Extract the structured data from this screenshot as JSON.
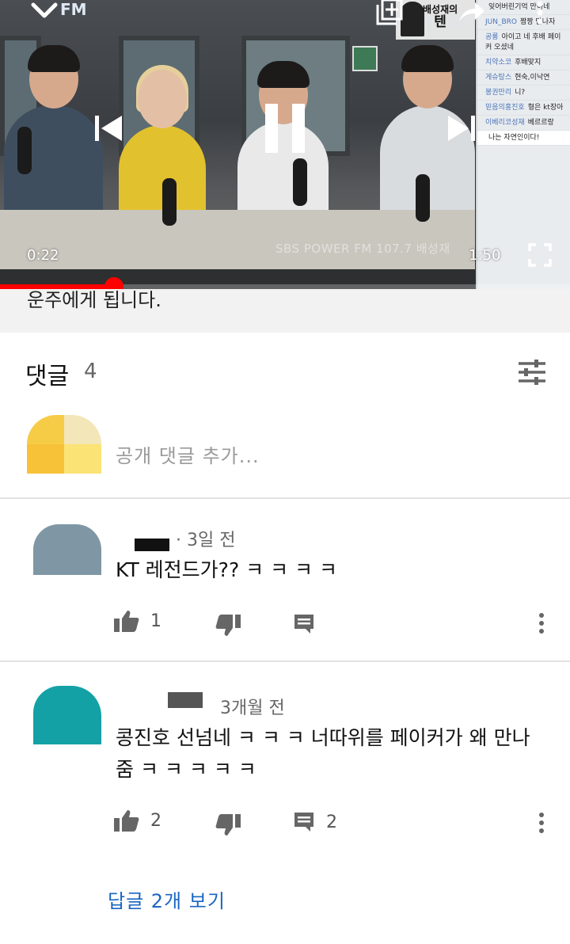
{
  "player": {
    "logo_text": "FM",
    "watermark": "SBS POWER FM 107.7 배성재",
    "current_time": "0:22",
    "duration": "1:50",
    "progress": 0.2,
    "show_badge_line1": "배성재의",
    "show_badge_line2": "텐",
    "side_chat": [
      {
        "user": "",
        "text": "잊어버린기억 만하네"
      },
      {
        "user": "JUN_BRO",
        "text": "짬짱 만나자"
      },
      {
        "user": "공룡",
        "text": "아이고 네 후배 페이커 오셨네"
      },
      {
        "user": "치약소코",
        "text": "후배맞지"
      },
      {
        "user": "게슈탕스",
        "text": "현숙,이낙연"
      },
      {
        "user": "봉권만리",
        "text": "니?"
      },
      {
        "user": "믿음의홍진호",
        "text": "형은 kt장아"
      },
      {
        "user": "이베리코성재",
        "text": "베르르랑"
      },
      {
        "user": "",
        "text": "나는 자연인이다!"
      }
    ]
  },
  "description": {
    "text": "운주에게 됩니다."
  },
  "comments": {
    "title": "댓글",
    "count": "4",
    "add_placeholder": "공개 댓글 추가...",
    "items": [
      {
        "time": "3일 전",
        "text": "KT 레전드가?? ㅋ ㅋ ㅋ ㅋ",
        "likes": "1",
        "replies": ""
      },
      {
        "time": "3개월 전",
        "text": "콩진호 선넘네 ㅋ ㅋ ㅋ 너따위를 페이커가 왜 만나줌 ㅋ ㅋ ㅋ ㅋ ㅋ",
        "likes": "2",
        "replies": "2",
        "view_replies": "답글 2개 보기"
      }
    ]
  },
  "colors": {
    "progress": "#ff0000",
    "link": "#1a66c2",
    "divider": "#e3e3e3"
  }
}
